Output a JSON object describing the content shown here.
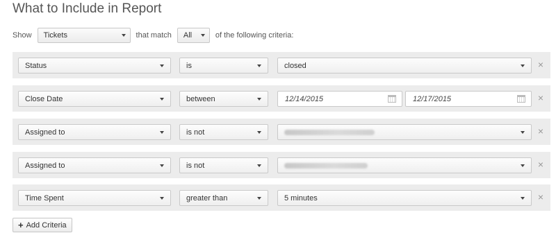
{
  "title": "What to Include in Report",
  "show": {
    "show_label": "Show",
    "type_value": "Tickets",
    "match_label": "that match",
    "match_value": "All",
    "criteria_label": "of the following criteria:"
  },
  "criteria": [
    {
      "field": "Status",
      "operator": "is",
      "value": "closed"
    },
    {
      "field": "Close Date",
      "operator": "between",
      "date_from": "12/14/2015",
      "date_to": "12/17/2015"
    },
    {
      "field": "Assigned to",
      "operator": "is not",
      "value": ""
    },
    {
      "field": "Assigned to",
      "operator": "is not",
      "value": ""
    },
    {
      "field": "Time Spent",
      "operator": "greater than",
      "value": "5 minutes"
    }
  ],
  "remove_glyph": "×",
  "add_criteria_label": "Add Criteria",
  "icons": {
    "dropdown": "chevron-down-icon",
    "remove": "close-icon",
    "calendar": "calendar-icon",
    "add": "plus-icon"
  }
}
